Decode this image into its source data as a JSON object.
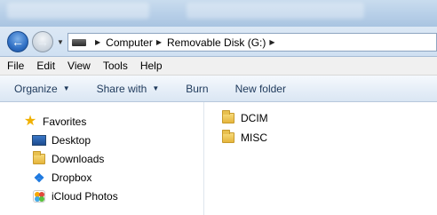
{
  "address": {
    "breadcrumbs": [
      "Computer",
      "Removable Disk (G:)"
    ]
  },
  "menu": [
    "File",
    "Edit",
    "View",
    "Tools",
    "Help"
  ],
  "toolbar": {
    "organize": "Organize",
    "share_with": "Share with",
    "burn": "Burn",
    "new_folder": "New folder"
  },
  "nav": {
    "favorites_label": "Favorites",
    "items": [
      {
        "label": "Desktop",
        "icon": "desktop-icon"
      },
      {
        "label": "Downloads",
        "icon": "folder-icon"
      },
      {
        "label": "Dropbox",
        "icon": "dropbox-icon"
      },
      {
        "label": "iCloud Photos",
        "icon": "icloud-photos-icon"
      }
    ]
  },
  "files": [
    {
      "name": "DCIM",
      "icon": "folder-icon"
    },
    {
      "name": "MISC",
      "icon": "folder-icon"
    }
  ],
  "colors": {
    "command_text": "#1e395b",
    "favorites_star": "#f0b000"
  }
}
